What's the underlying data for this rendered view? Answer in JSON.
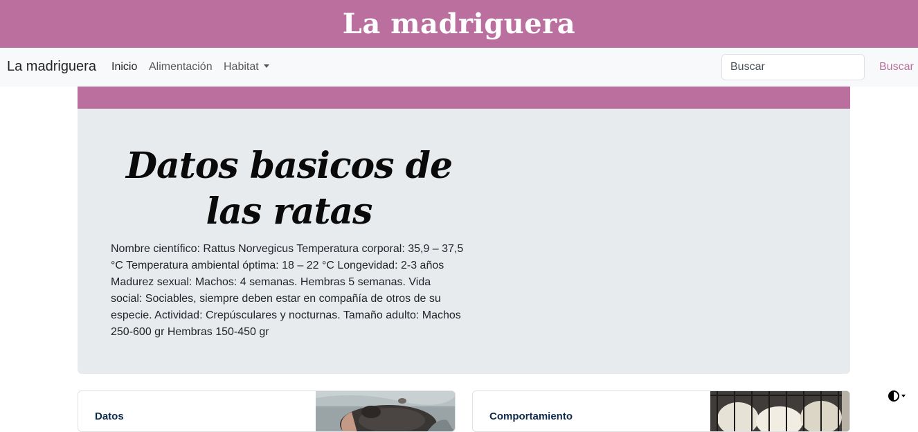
{
  "header": {
    "site_title": "La madriguera"
  },
  "navbar": {
    "brand": "La madriguera",
    "links": [
      {
        "label": "Inicio"
      },
      {
        "label": "Alimentación"
      },
      {
        "label": "Habitat"
      }
    ],
    "search": {
      "placeholder": "Buscar",
      "button_label": "Buscar"
    }
  },
  "hero": {
    "title": "Datos basicos de las ratas",
    "text": "Nombre científico: Rattus Norvegicus Temperatura corporal: 35,9 – 37,5 °C Temperatura ambiental óptima: 18 – 22 °C Longevidad: 2-3 años Madurez sexual: Machos: 4 semanas. Hembras 5 semanas. Vida social: Sociables, siempre deben estar en compañía de otros de su especie. Actividad: Crepúsculares y nocturnas. Tamaño adulto: Machos 250-600 gr Hembras 150-450 gr"
  },
  "cards": [
    {
      "title": "Datos"
    },
    {
      "title": "Comportamiento"
    }
  ],
  "theme": {
    "icon": "circle-half-icon"
  },
  "colors": {
    "brand": "#bb6f9e",
    "navbar_bg": "#f8f9fa",
    "hero_bg": "#e8ebee",
    "card_title": "#0d2a4a"
  }
}
